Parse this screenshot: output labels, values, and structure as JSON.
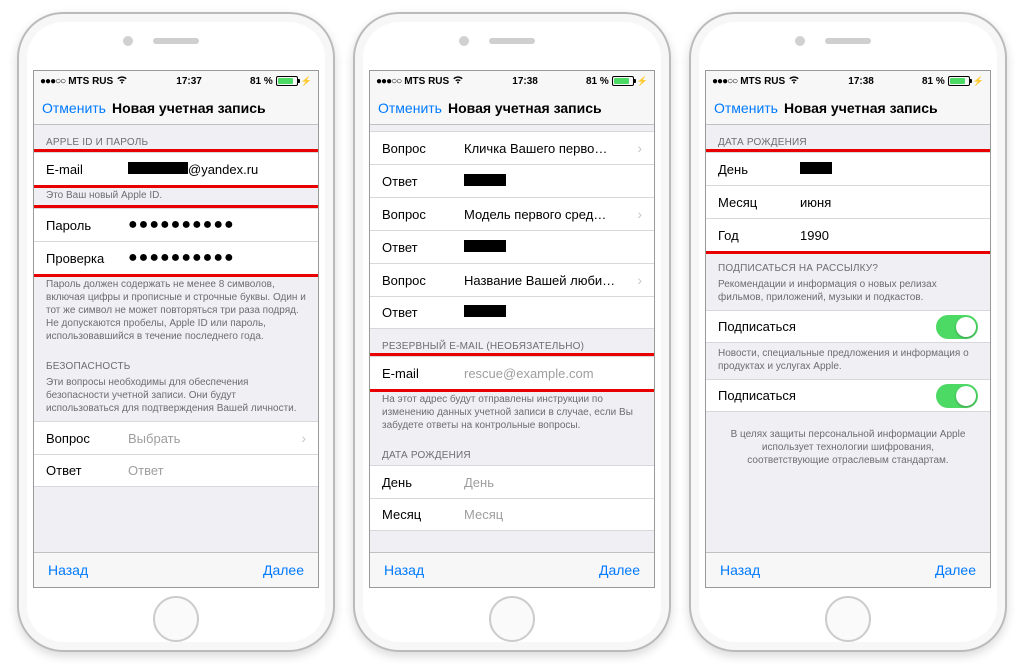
{
  "status": {
    "carrier": "MTS RUS",
    "time1": "17:37",
    "time2": "17:38",
    "time3": "17:38",
    "battery": "81 %"
  },
  "nav": {
    "cancel": "Отменить",
    "title": "Новая учетная запись",
    "back": "Назад",
    "next": "Далее"
  },
  "screen1": {
    "h_appleid": "APPLE ID И ПАРОЛЬ",
    "email_label": "E-mail",
    "email_value": "@yandex.ru",
    "appleid_footer": "Это Ваш новый Apple ID.",
    "password_label": "Пароль",
    "verify_label": "Проверка",
    "password_dots": "●●●●●●●●●●",
    "pwd_footer": "Пароль должен содержать не менее 8 символов, включая цифры и прописные и строчные буквы. Один и тот же символ не может повторяться три раза подряд. Не допускаются пробелы, Apple ID или пароль, использовавшийся в течение последнего года.",
    "h_security": "БЕЗОПАСНОСТЬ",
    "sec_footer": "Эти вопросы необходимы для обеспечения безопасности учетной записи. Они будут использоваться для подтверждения Вашей личности.",
    "question_label": "Вопрос",
    "question_ph": "Выбрать",
    "answer_label": "Ответ",
    "answer_ph": "Ответ"
  },
  "screen2": {
    "q1": "Кличка Вашего перво…",
    "q2": "Модель первого сред…",
    "q3": "Название Вашей люби…",
    "question_label": "Вопрос",
    "answer_label": "Ответ",
    "h_rescue": "РЕЗЕРВНЫЙ E-MAIL (НЕОБЯЗАТЕЛЬНО)",
    "email_label": "E-mail",
    "email_ph": "rescue@example.com",
    "rescue_footer": "На этот адрес будут отправлены инструкции по изменению данных учетной записи в случае, если Вы забудете ответы на контрольные вопросы.",
    "h_dob": "ДАТА РОЖДЕНИЯ",
    "day_label": "День",
    "day_ph": "День",
    "month_label": "Месяц",
    "month_ph": "Месяц"
  },
  "screen3": {
    "h_dob": "ДАТА РОЖДЕНИЯ",
    "day_label": "День",
    "month_label": "Месяц",
    "month_val": "июня",
    "year_label": "Год",
    "year_val": "1990",
    "h_sub": "ПОДПИСАТЬСЯ НА РАССЫЛКУ?",
    "sub_footer1": "Рекомендации и информация о новых релизах фильмов, приложений, музыки и подкастов.",
    "subscribe": "Подписаться",
    "sub_footer2": "Новости, специальные предложения и информация о продуктах и услугах Apple.",
    "privacy": "В целях защиты персональной информации Apple использует технологии шифрования, соответствующие отраслевым стандартам."
  }
}
